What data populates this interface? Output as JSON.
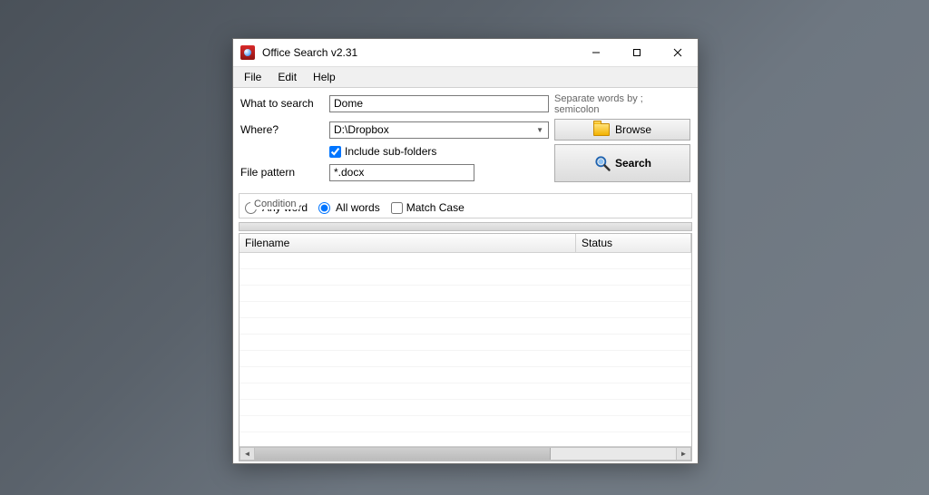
{
  "title": "Office Search v2.31",
  "menu": {
    "file": "File",
    "edit": "Edit",
    "help": "Help"
  },
  "labels": {
    "what_to_search": "What to search",
    "where": "Where?",
    "file_pattern": "File pattern",
    "hint": "Separate words by ; semicolon",
    "browse": "Browse",
    "include_sub": "Include sub-folders",
    "search": "Search",
    "condition": "Condition",
    "any_word": "Any word",
    "all_words": "All words",
    "match_case": "Match Case"
  },
  "values": {
    "search_text": "Dome",
    "where_path": "D:\\Dropbox",
    "file_pattern": "*.docx",
    "include_sub_checked": true,
    "any_word_selected": false,
    "all_words_selected": true,
    "match_case_checked": false
  },
  "list": {
    "col_filename": "Filename",
    "col_status": "Status"
  }
}
